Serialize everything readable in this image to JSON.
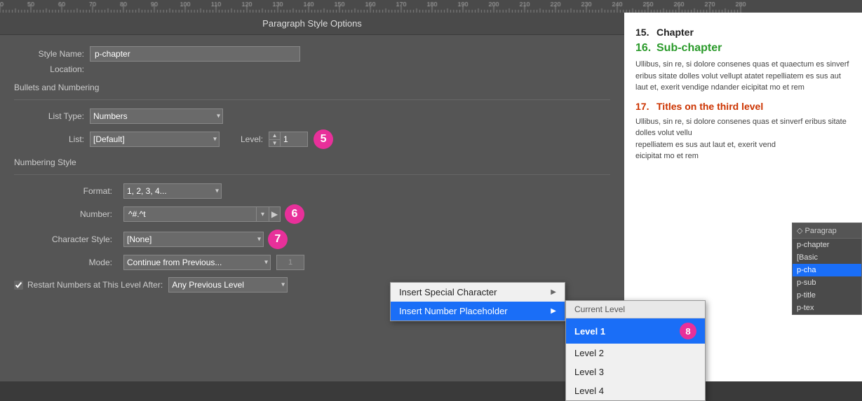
{
  "ruler": {
    "label": "ruler",
    "ticks": [
      50,
      60,
      70,
      80,
      90,
      100,
      110,
      120,
      130,
      140,
      150,
      160,
      170,
      180,
      190,
      200,
      210,
      220,
      230,
      240,
      250,
      260,
      270
    ]
  },
  "dialog": {
    "title": "Paragraph Style Options",
    "style_name_label": "Style Name:",
    "style_name_value": "p-chapter",
    "location_label": "Location:",
    "section_bullets": "Bullets and Numbering",
    "list_type_label": "List Type:",
    "list_type_value": "Numbers",
    "list_label": "List:",
    "list_value": "[Default]",
    "level_label": "Level:",
    "level_value": "1",
    "section_numbering": "Numbering Style",
    "format_label": "Format:",
    "format_value": "1, 2, 3, 4...",
    "number_label": "Number:",
    "number_value": "^#.^t",
    "char_style_label": "Character Style:",
    "char_style_value": "[None]",
    "mode_label": "Mode:",
    "mode_value": "Continue from Previous...",
    "restart_label": "Restart Numbers at This Level After:",
    "any_prev_value": "Any Previous Level",
    "badge5": "5",
    "badge6": "6",
    "badge7": "7",
    "badge8": "8"
  },
  "context_menu": {
    "item1_label": "Insert Special Character",
    "item2_label": "Insert Number Placeholder",
    "submenu_header": "Current Level",
    "submenu_items": [
      {
        "label": "Level 1",
        "active": true
      },
      {
        "label": "Level 2",
        "active": false
      },
      {
        "label": "Level 3",
        "active": false
      },
      {
        "label": "Level 4",
        "active": false
      }
    ]
  },
  "doc_preview": {
    "line1_num": "15.",
    "line1_text": "Chapter",
    "line2_num": "16.",
    "line2_text": "Sub-chapter",
    "body1": "Ullibus, sin re, si dolore consenes quas et quaectum es sinverf eribus sitate dolles volut vellupt atatet repelliatem es sus aut laut et, exerit vendige ndander eicipitat mo et rem",
    "line3_num": "17.",
    "line3_text": "Titles on the third level",
    "body2": "Ullibus, sin re, si dolore consenes quas et sinverf eribus sitate dolles volut vellu repelliatem es sus aut laut et, exerit vend eicipitat mo et rem",
    "body3": "et, exerit vend"
  },
  "para_styles": {
    "header": "◇ Paragrap",
    "items": [
      {
        "label": "p-chapter",
        "active": false
      },
      {
        "label": "[Basic",
        "active": false
      },
      {
        "label": "p-cha",
        "active": true
      },
      {
        "label": "p-sub",
        "active": false
      },
      {
        "label": "p-title",
        "active": false
      },
      {
        "label": "p-tex",
        "active": false
      }
    ]
  }
}
